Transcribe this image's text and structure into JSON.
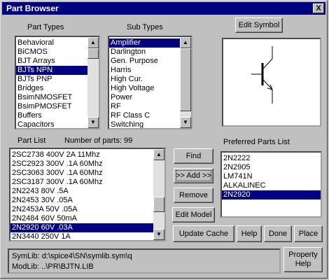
{
  "window": {
    "title": "Part Browser",
    "close_label": "X"
  },
  "part_types": {
    "label": "Part Types",
    "items": [
      "Behavioral",
      "BiCMOS",
      "BJT Arrays",
      "BJTs NPN",
      "BJTs PNP",
      "Bridges",
      "BsimNMOSFET",
      " BsimPMOSFET",
      "Buffers",
      "Capacitors"
    ],
    "selected_index": 3
  },
  "sub_types": {
    "label": "Sub Types",
    "items": [
      "Amplifier",
      "Darlington",
      "Gen. Purpose",
      "Harris",
      "High Cur.",
      "High Voltage",
      "Power",
      "RF",
      "RF Class C",
      "Switching"
    ],
    "selected_index": 0
  },
  "edit_symbol_label": "Edit Symbol",
  "part_list": {
    "label": "Part List",
    "count_label": "Number of parts: 99",
    "items": [
      "2SC2738   400V 2A 11Mhz",
      "2SC2923   300V .1A 60Mhz",
      "2SC3063   300V .1A 60Mhz",
      "2SC3187   300V .1A 60Mhz",
      "2N2243   80V .5A",
      "2N2453   30V .05A",
      "2N2453A   50V .05A",
      "2N2484   60V 50mA",
      "2N2920   60V .03A",
      "2N3440   250V 1A"
    ],
    "selected_index": 8
  },
  "actions": {
    "find": "Find",
    "add": ">> Add >>",
    "remove": "Remove",
    "edit_model": "Edit Model"
  },
  "preferred": {
    "label": "Preferred Parts List",
    "items": [
      "2N2222",
      "2N2905",
      "LM741N",
      "ALKALINEC",
      "2N2920"
    ],
    "selected_index": 4
  },
  "bottom_buttons": {
    "update_cache": "Update  Cache",
    "help": "Help",
    "done": "Done",
    "place": "Place"
  },
  "status": {
    "symlib": "SymLib:  d:\\spice4\\SN\\symlib.sym\\q",
    "modlib": "ModLib:  ..\\PR\\BJTN.LIB"
  },
  "property_help": {
    "line1": "Property",
    "line2": "Help"
  },
  "icons": {
    "close": "close-icon",
    "up": "scroll-up-arrow-icon",
    "down": "scroll-down-arrow-icon",
    "symbol": "npn-transistor-symbol"
  }
}
